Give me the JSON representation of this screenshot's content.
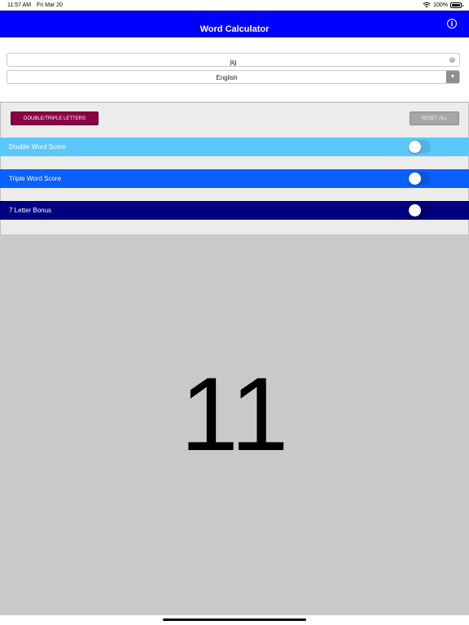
{
  "status_bar": {
    "time": "11:57 AM",
    "date": "Fri Mar 20",
    "battery": "100%",
    "icons": [
      "wifi-icon",
      "battery-icon"
    ]
  },
  "header": {
    "title": "Word Calculator",
    "info_icon": "info-icon",
    "info_glyph": "i"
  },
  "form": {
    "word_value": "jig",
    "clear_glyph": "×",
    "language": "English",
    "dropdown_glyph": "▼"
  },
  "buttons": {
    "double_triple_letters": "DOUBLE/TRIPLE LETTERS",
    "reset_all": "RESET ALL"
  },
  "toggles": [
    {
      "label": "Double Word Score",
      "on": false,
      "color": "#5ac8fa"
    },
    {
      "label": "Triple Word Score",
      "on": false,
      "color": "#0a60ff"
    },
    {
      "label": "7 Letter Bonus",
      "on": false,
      "color": "#000080"
    }
  ],
  "score": "11",
  "colors": {
    "header": "#0000ff",
    "double_triple_button": "#8b0046",
    "reset_button": "#a6a6a6",
    "score_background": "#c9c9c9"
  }
}
